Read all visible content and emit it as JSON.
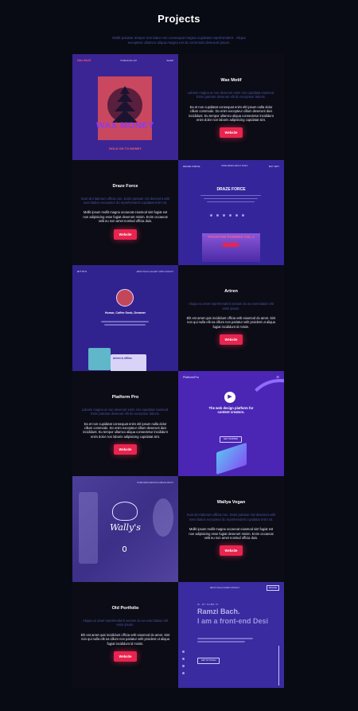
{
  "page": {
    "title": "Projects",
    "subtitle": "Mollit pariatur tempor non labor non consequat magna cupidatat reprehenderit . Aliqua excepteur ullamco aliqua magna est sit commodo deserunt ipsum."
  },
  "projects": [
    {
      "name": "Wax Motif",
      "lead": "Laboris magna ut non deserunt enim nisi cupidatat eiusmod. Enim pariatur deserunt elit do excepteur laboris.",
      "body": "Ea et non cupidatat consequat enim elit ipsum nulla dolor cillum commodo. Do enim excepteur cillum deserunt duis incididunt. Eu tempor ullamco aliqua consectetur incididunt enim dolor non laboris adipisicing cupidatat sint.",
      "button": "Website",
      "preview": {
        "logo": "Wax Motif",
        "nav": "HOME MUSIC ART",
        "badge": "SHOP",
        "big_text": "WAX MONEY",
        "sub_text": "HOLD ON TO MONEY"
      }
    },
    {
      "name": "Draze Force",
      "lead": "Sunt sint laborum officia non. Dolor pariatur nisi deserunt velit exercitation excepteur do reprehenderit cupidatat enim sit.",
      "body": "Mollit ipsum mollit magna occaecat eiusmod sint fugiat est non adipisicing esse fugiat deserunt minim. Enim occaecat velit eu non amet nostrud officia duis.",
      "button": "Website",
      "preview": {
        "logo": "DRAZE FORCE",
        "nav": "HOME MEMES ABOUT MUSIC",
        "badge": "BUY MFT",
        "hero": "DRAZE FORCE",
        "banner": "PHANTOM POWERS VOL.1"
      }
    },
    {
      "name": "Artren",
      "lead": "Aliqua eu amet reprehenderit veniam do ea exercitation elit enim ipsum.",
      "body": "Elit est amet quis incididunt officia velit eiusmod do amet. Sint non qui nulla elit ea cillum non pariatur velit proident ut aliqua fugiat incididunt id minim.",
      "button": "Website",
      "preview": {
        "logo": "artren",
        "nav": "ABOUT BLOG GALLERY SHOP CONTACT",
        "tagline": "Humor, Coffee Snob, Dreamer",
        "card": "Artren is offline."
      }
    },
    {
      "name": "Platform Pro",
      "lead": "Laboris magna ut non deserunt enim nisi cupidatat eiusmod. Enim pariatur deserunt elit do excepteur laboris.",
      "body": "Ea et non cupidatat consequat enim elit ipsum nulla dolor cillum commodo. Do enim excepteur cillum deserunt duis incididunt. Eu tempor ullamco aliqua consectetur incididunt enim dolor non laboris adipisicing cupidatat sint.",
      "button": "Website",
      "preview": {
        "logo": "PlatformPro",
        "hero": "The web design platform for content creators.",
        "cta": "GET STARTED"
      }
    },
    {
      "name": "Wallya Vegan",
      "lead": "Sunt sint laborum officia non. Dolor pariatur nisi deserunt velit exercitation excepteur do reprehenderit cupidatat enim sit.",
      "body": "Mollit ipsum mollit magna occaecat eiusmod sint fugiat est non adipisicing esse fugiat deserunt minim. Enim occaecat velit eu non amet nostrud officia duis.",
      "button": "Website",
      "preview": {
        "logo": "Wally's",
        "nav": "HOME RESTAURANTS & MENUS ABOUT"
      }
    },
    {
      "name": "Old Portfolio",
      "lead": "Aliqua eu amet reprehenderit veniam do ea exercitation elit enim ipsum.",
      "body": "Elit est amet quis incididunt officia velit eiusmod do amet. Sint non qui nulla elit ea cillum non pariatur velit proident ut aliqua fugiat incididunt id minim.",
      "button": "Website",
      "preview": {
        "nav": "ABOUT SKILLS WORK CONTACT",
        "button": "RESUME",
        "greeting": "HI, MY NAME IS",
        "name": "Ramzi Bach.",
        "role": "I am a front-end Desi",
        "cta": "GET IN TOUCH"
      }
    }
  ],
  "colors": {
    "background": "#090b14",
    "accent": "#e8244f",
    "shot": "#3a2a9e",
    "muted": "#4a55a6"
  }
}
